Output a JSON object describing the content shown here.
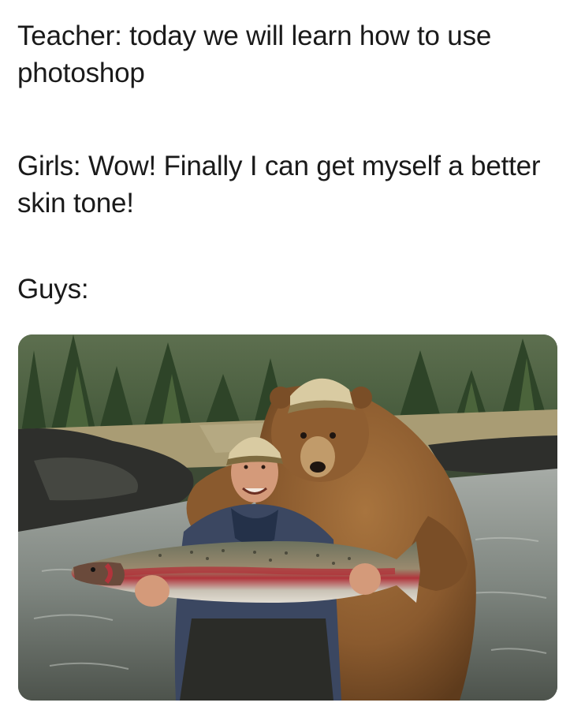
{
  "meme": {
    "teacher_line": "Teacher: today we will learn how to use photoshop",
    "girls_line": "Girls: Wow! Finally I can get myself a better skin tone!",
    "guys_line": "Guys:"
  },
  "photo": {
    "subject": "man and bear in caps holding a large trout in a river",
    "colors": {
      "forest": "#3f5a36",
      "bank": "#a99c74",
      "water": "#8f9793",
      "rock": "#2e2f2c",
      "bear_fur": "#8a5a2e",
      "cap": "#d9cba2",
      "jacket": "#3b4761",
      "fish_stripe": "#b0343b"
    }
  }
}
